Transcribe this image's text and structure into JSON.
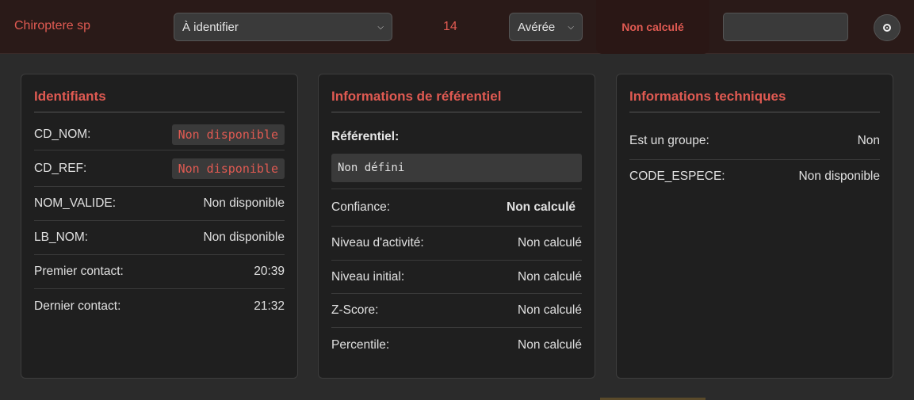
{
  "topbar": {
    "species": "Chiroptere sp",
    "identification_select": "À identifier",
    "count": "14",
    "status_select": "Avérée",
    "confidence_badge": "Non calculé",
    "text_input_value": ""
  },
  "identifiants": {
    "title": "Identifiants",
    "rows": [
      {
        "label": "CD_NOM:",
        "value": "Non disponible"
      },
      {
        "label": "CD_REF:",
        "value": "Non disponible"
      },
      {
        "label": "NOM_VALIDE:",
        "value": "Non disponible"
      },
      {
        "label": "LB_NOM:",
        "value": "Non disponible"
      },
      {
        "label": "Premier contact:",
        "value": "20:39"
      },
      {
        "label": "Dernier contact:",
        "value": "21:32"
      }
    ]
  },
  "referentiel": {
    "title": "Informations de référentiel",
    "ref_label": "Référentiel:",
    "ref_value": "Non défini",
    "rows": [
      {
        "label": "Confiance:",
        "value": "Non calculé"
      },
      {
        "label": "Niveau d'activité:",
        "value": "Non calculé"
      },
      {
        "label": "Niveau initial:",
        "value": "Non calculé"
      },
      {
        "label": "Z-Score:",
        "value": "Non calculé"
      },
      {
        "label": "Percentile:",
        "value": "Non calculé"
      }
    ]
  },
  "techniques": {
    "title": "Informations techniques",
    "rows": [
      {
        "label": "Est un groupe:",
        "value": "Non"
      },
      {
        "label": "CODE_ESPECE:",
        "value": "Non disponible"
      }
    ]
  },
  "colors": {
    "accent": "#e05a52",
    "panel_bg": "#1f1f1f",
    "topbar_bg": "#2a1a18"
  },
  "icons": {
    "select_chevron": "chevron-down-icon",
    "radio": "radio-icon"
  }
}
